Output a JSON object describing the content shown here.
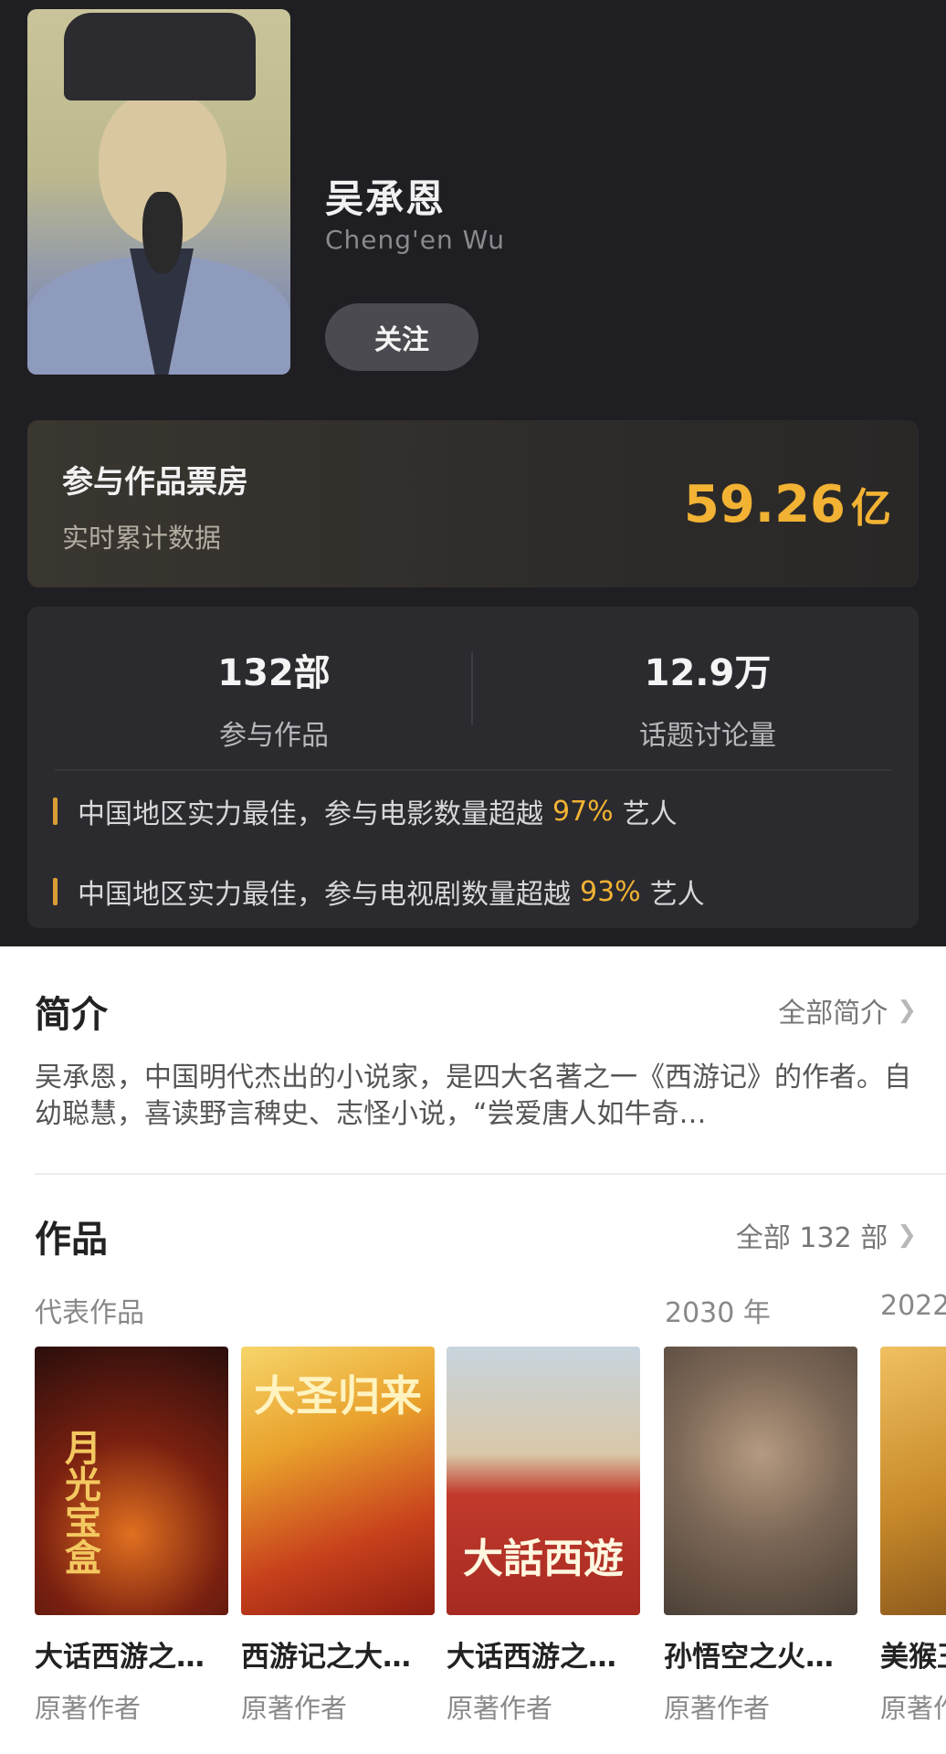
{
  "profile": {
    "name": "吴承恩",
    "name_en": "Cheng'en Wu",
    "follow_label": "关注"
  },
  "box_office": {
    "title": "参与作品票房",
    "subtitle": "实时累计数据",
    "value": "59.26",
    "unit": "亿"
  },
  "stats": {
    "works_count": "132部",
    "works_label": "参与作品",
    "discussion_count": "12.9万",
    "discussion_label": "话题讨论量"
  },
  "rankings": [
    {
      "prefix": "中国地区实力最佳，参与电影数量超越",
      "percent": "97%",
      "suffix": "艺人"
    },
    {
      "prefix": "中国地区实力最佳，参与电视剧数量超越",
      "percent": "93%",
      "suffix": "艺人"
    }
  ],
  "intro": {
    "heading": "简介",
    "more_label": "全部简介",
    "text": "吴承恩，中国明代杰出的小说家，是四大名著之一《西游记》的作者。自幼聪慧，喜读野言稗史、志怪小说，“尝爱唐人如牛奇…"
  },
  "works": {
    "heading": "作品",
    "more_label": "全部 132 部",
    "group_labels": [
      "代表作品",
      "2030 年",
      "2022"
    ],
    "items": [
      {
        "title": "大话西游之…",
        "role": "原著作者",
        "poster_text": "月光宝盒"
      },
      {
        "title": "西游记之大…",
        "role": "原著作者",
        "poster_text": "大圣归来"
      },
      {
        "title": "大话西游之…",
        "role": "原著作者",
        "poster_text": "大話西遊"
      },
      {
        "title": "孙悟空之火…",
        "role": "原著作者",
        "poster_text": ""
      },
      {
        "title": "美猴王",
        "role": "原著作者",
        "poster_text": ""
      }
    ]
  },
  "icons": {
    "chevron": "chevron-right-icon"
  }
}
